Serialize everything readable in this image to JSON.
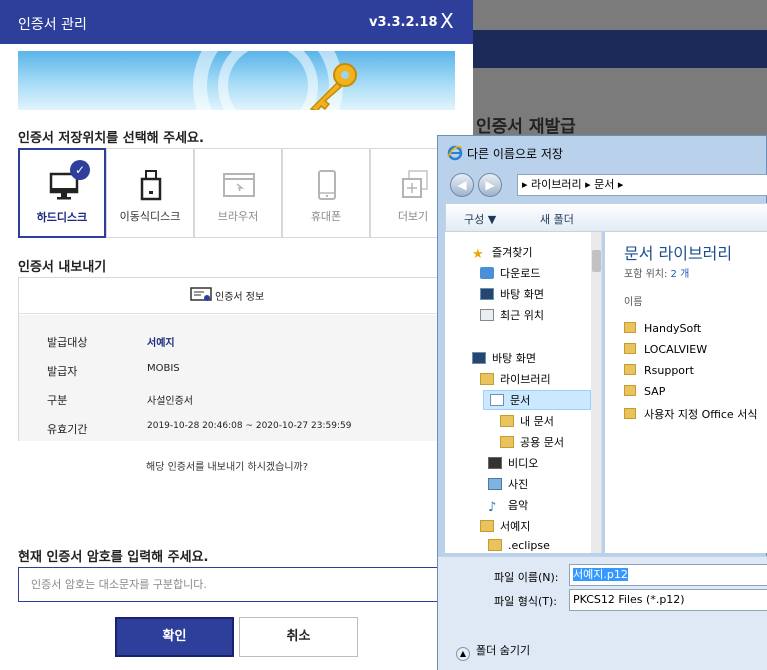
{
  "cert_manager": {
    "title": "인증서 관리",
    "version": "v3.3.2.18",
    "close_glyph": "X",
    "location_heading": "인증서 저장위치를 선택해 주세요.",
    "locations": [
      {
        "label": "하드디스크",
        "selected": true,
        "enabled": true,
        "icon": "monitor-icon"
      },
      {
        "label": "이동식디스크",
        "selected": false,
        "enabled": true,
        "icon": "usb-drive-icon"
      },
      {
        "label": "브라우저",
        "selected": false,
        "enabled": false,
        "icon": "browser-window-icon"
      },
      {
        "label": "휴대폰",
        "selected": false,
        "enabled": false,
        "icon": "mobile-phone-icon"
      },
      {
        "label": "더보기",
        "selected": false,
        "enabled": false,
        "icon": "more-icon"
      }
    ],
    "export_heading": "인증서 내보내기",
    "cert_info_label": "인증서 정보",
    "info": [
      {
        "key": "발급대상",
        "value": "서예지"
      },
      {
        "key": "발급자",
        "value": "MOBIS"
      },
      {
        "key": "구분",
        "value": "사설인증서"
      },
      {
        "key": "유효기간",
        "value": "2019-10-28 20:46:08 ~ 2020-10-27 23:59:59"
      }
    ],
    "confirm_question": "해당 인증서를 내보내기 하시겠습니까?",
    "password_heading": "현재 인증서 암호를 입력해 주세요.",
    "password_placeholder": "인증서 암호는 대소문자를 구분합니다.",
    "ok_label": "확인",
    "cancel_label": "취소",
    "accent_color": "#2e3f9b"
  },
  "background": {
    "reissue_text": "인증서 재발급"
  },
  "save_dialog": {
    "title": "다른 이름으로 저장",
    "breadcrumb": [
      "라이브러리",
      "문서"
    ],
    "organize_label": "구성 ▼",
    "new_folder_label": "새 폴더",
    "tree": [
      {
        "label": "즐겨찾기",
        "icon": "star-icon"
      },
      {
        "label": "다운로드",
        "icon": "download-folder-icon"
      },
      {
        "label": "바탕 화면",
        "icon": "desktop-icon"
      },
      {
        "label": "최근 위치",
        "icon": "recent-places-icon"
      },
      {
        "label": "바탕 화면",
        "icon": "desktop-icon"
      },
      {
        "label": "라이브러리",
        "icon": "library-icon"
      },
      {
        "label": "문서",
        "icon": "documents-icon",
        "selected": true
      },
      {
        "label": "내 문서",
        "icon": "folder-icon"
      },
      {
        "label": "공용 문서",
        "icon": "folder-icon"
      },
      {
        "label": "비디오",
        "icon": "video-icon"
      },
      {
        "label": "사진",
        "icon": "pictures-icon"
      },
      {
        "label": "음악",
        "icon": "music-icon"
      },
      {
        "label": "서예지",
        "icon": "user-folder-icon"
      },
      {
        "label": ".eclipse",
        "icon": "folder-icon"
      }
    ],
    "library_title": "문서 라이브러리",
    "library_includes": "포함 위치: ",
    "library_count": "2 개",
    "column_name": "이름",
    "files": [
      "HandySoft",
      "LOCALVIEW",
      "Rsupport",
      "SAP",
      "사용자 지정 Office 서식"
    ],
    "filename_label": "파일 이름(N):",
    "filename_value": "서예지.p12",
    "filetype_label": "파일 형식(T):",
    "filetype_value": "PKCS12 Files (*.p12)",
    "hide_folders_label": "폴더 숨기기"
  }
}
